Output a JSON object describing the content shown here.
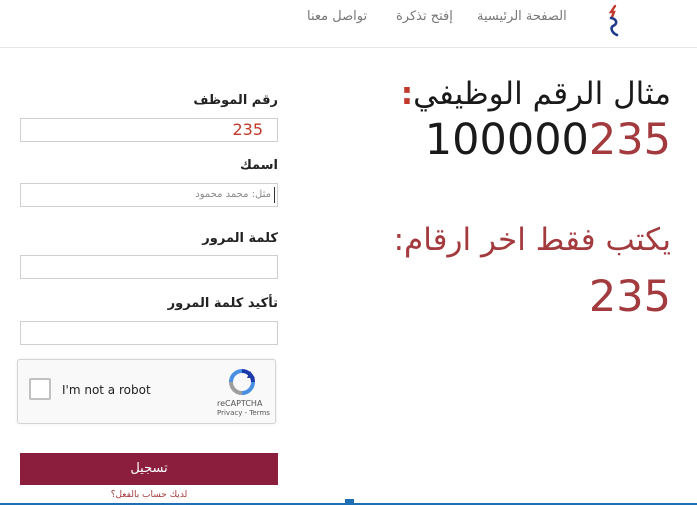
{
  "nav": {
    "home": "الصفحة الرئيسية",
    "open_ticket": "إفتح تذكرة",
    "contact": "تواصل معنا"
  },
  "example": {
    "title": "مثال الرقم الوظيفي",
    "colon": ":",
    "number_prefix": "100000",
    "number_suffix": "235"
  },
  "hint": {
    "text": "يكتب فقط اخر ارقام",
    "colon": ":",
    "number": "235"
  },
  "form": {
    "employee_id_label": "رقم الموظف",
    "employee_id_value": "235",
    "name_label": "اسمك",
    "name_placeholder": "مثل: محمد محمود",
    "password_label": "كلمة المرور",
    "confirm_password_label": "تأكيد كلمة المرور",
    "submit_label": "تسجيل",
    "login_link": "لديك حساب بالفعل؟"
  },
  "recaptcha": {
    "label": "I'm not a robot",
    "brand": "reCAPTCHA",
    "links": "Privacy - Terms"
  },
  "colors": {
    "accent": "#8b1d3d",
    "highlight": "#a33a3e",
    "value_red": "#c0392b",
    "bottom_bar": "#1f6fb5"
  }
}
